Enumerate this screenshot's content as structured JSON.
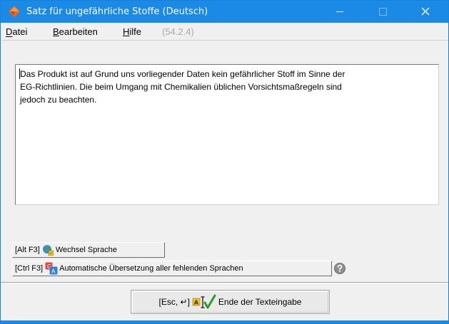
{
  "window": {
    "title": "Satz für ungefährliche Stoffe (Deutsch)",
    "accent_color": "#1a8ae6",
    "icons": {
      "app": "diamond-app-icon",
      "minimize": "minimize-icon",
      "maximize": "maximize-icon",
      "close": "close-icon"
    }
  },
  "menu": {
    "items": [
      {
        "label": "Datei",
        "underline": "D"
      },
      {
        "label": "Bearbeiten",
        "underline": "B"
      },
      {
        "label": "Hilfe",
        "underline": "H"
      }
    ],
    "version": "(54.2.4)"
  },
  "editor": {
    "text": "Das Produkt ist auf Grund uns vorliegender Daten kein gefährlicher Stoff im Sinne der\nEG-Richtlinien. Die beim Umgang mit Chemikalien üblichen Vorsichtsmaßregeln sind\njedoch zu beachten."
  },
  "buttons": {
    "switch_language": {
      "shortcut": "[Alt F3]",
      "label": "Wechsel Sprache",
      "icon": "globe-language-icon"
    },
    "auto_translate": {
      "shortcut": "[Ctrl F3]",
      "label": "Automatische Übersetzung aller fehlenden Sprachen",
      "icon": "translate-icon"
    },
    "help": {
      "icon": "help-icon"
    },
    "finish": {
      "shortcut": "[Esc, ↵]",
      "label": "Ende der Texteingabe",
      "icon": "text-check-icon"
    }
  }
}
